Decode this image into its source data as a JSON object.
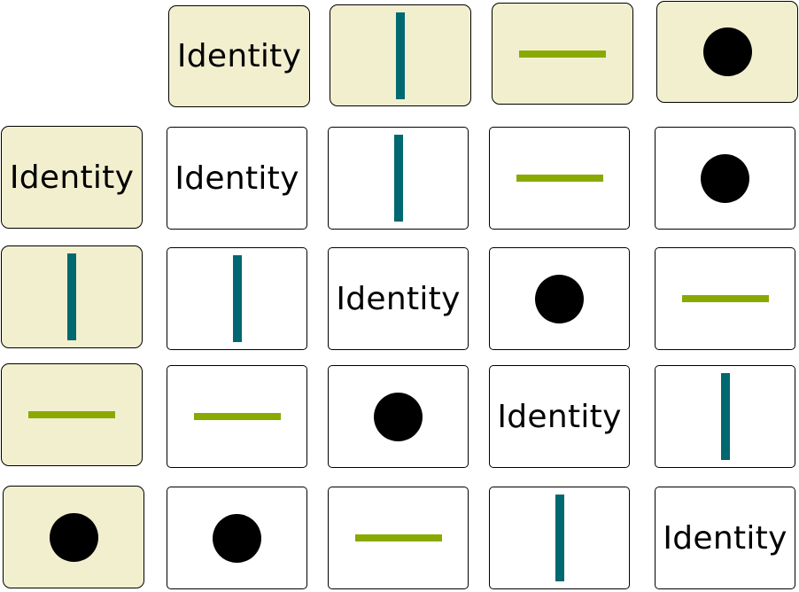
{
  "colors": {
    "header_fill": "#f2efcf",
    "vertical": "#006870",
    "horizontal": "#88aa00",
    "circle": "#000000"
  },
  "labels": {
    "identity": "Identity"
  },
  "column_headers": [
    "identity",
    "vertical",
    "horizontal",
    "circle"
  ],
  "row_headers": [
    "identity",
    "vertical",
    "horizontal",
    "circle"
  ],
  "table": [
    [
      "identity",
      "vertical",
      "horizontal",
      "circle"
    ],
    [
      "vertical",
      "identity",
      "circle",
      "horizontal"
    ],
    [
      "horizontal",
      "circle",
      "identity",
      "vertical"
    ],
    [
      "circle",
      "horizontal",
      "vertical",
      "identity"
    ]
  ]
}
